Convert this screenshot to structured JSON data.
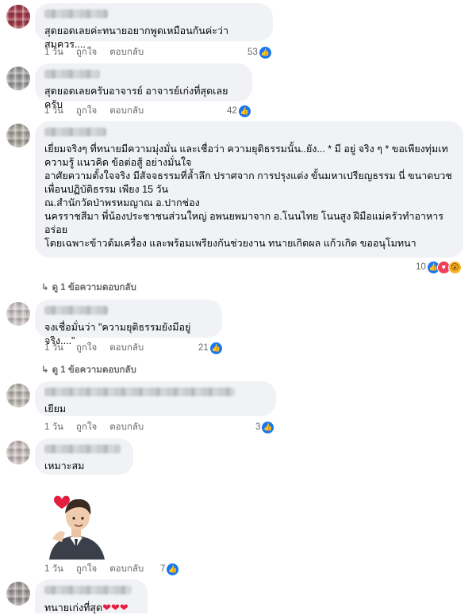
{
  "labels": {
    "like": "ถูกใจ",
    "reply": "ตอบกลับ"
  },
  "comments": [
    {
      "text": "สุดยอดเลยค่ะทนายอยากพูดเหมือนกันค่ะว่าสมควร....",
      "time": "1 วัน",
      "reactions": "53"
    },
    {
      "text": "สุดยอดเลยครับอาจารย์ อาจารย์เก่งที่สุดเลยครับ",
      "time": "1 วัน",
      "reactions": "42"
    },
    {
      "text": "เยี่ยมจริงๆ ที่ทนายมีความมุ่งมั่น และเชื่อว่า ความยุติธรรมนั้น..ยัง... * มี อยู่ จริง ๆ * ขอเพียงทุ่มเท\nความรู้ แนวคิด ข้อต่อสู้ อย่างมั่นใจ\nอาศัยความตั้งใจจริง มีสัจจธรรมที่ล้ำลึก ปราศจาก การปรุงแต่ง ขั้นมหาเปรียญธรรม นี่ ขนาดบวช\nเพื่อนปฏิบัติธรรม เพียง 15 วัน\nณ.สำนักวัดป่าพรหมญาณ อ.ปากช่อง\nนครราชสีมา พี่น้องประชาชนส่วนใหญ่ อพนยพมาจาก อ.โนนไทย โนนสูง ฝีมือแม่ครัวทำอาหาร\nอร่อย\nโดยเฉพาะข้าวต้มเครื่อง และพร้อมเพรียงกันช่วยงาน ทนายเกิดผล แก้วเกิด ขออนุโมทนา",
      "reactions": "10",
      "replies": "ดู 1 ข้อความตอบกลับ"
    },
    {
      "text": "จงเชื่อมั่นว่า \"ความยุติธรรมยังมีอยู่จริง....\"",
      "time": "1 วัน",
      "reactions": "21",
      "replies": "ดู 1 ข้อความตอบกลับ"
    },
    {
      "text": "เยียม",
      "time": "1 วัน",
      "reactions": "3"
    },
    {
      "text": "เหมาะสม"
    },
    {
      "time": "1 วัน",
      "reactions": "7"
    },
    {
      "text": "ทนายเก่งที่สุด"
    }
  ],
  "icons": {
    "like": "thumbs-up-icon",
    "love": "heart-icon",
    "wow": "wow-icon",
    "reply_arrow": "reply-arrow-icon"
  },
  "colors": {
    "like": "#1877f2",
    "love": "#f33e58",
    "wow": "#f7b125",
    "bubble": "#f0f2f5",
    "meta": "#65676b"
  }
}
